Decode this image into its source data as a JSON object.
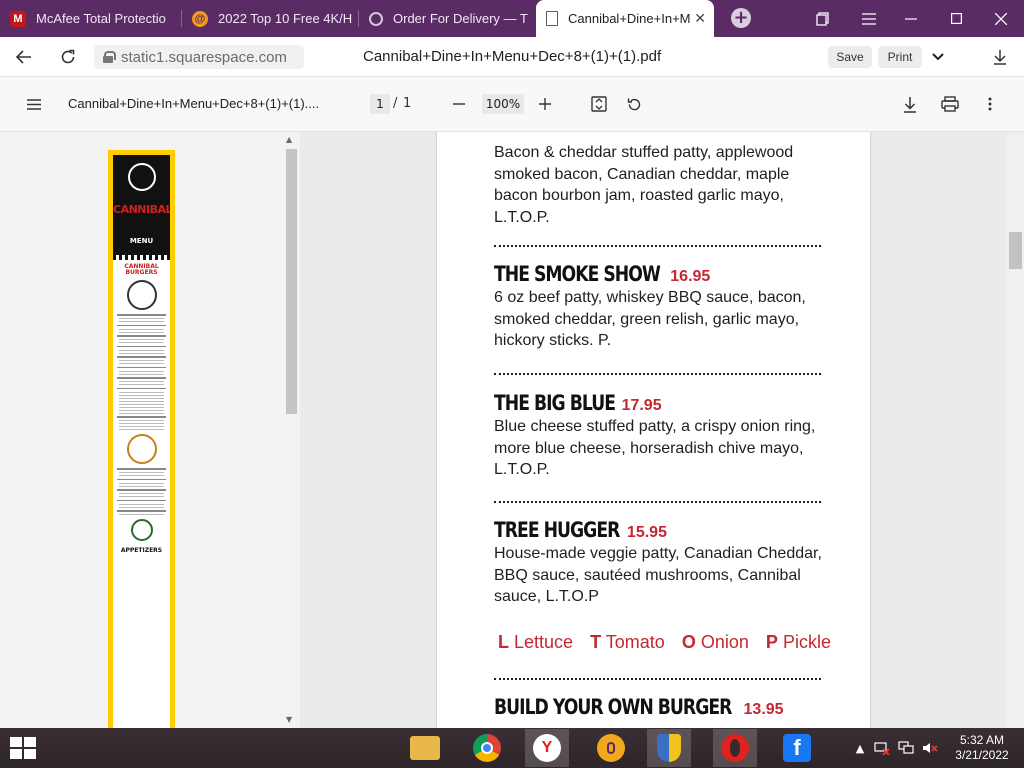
{
  "browser": {
    "tabs": [
      {
        "label": "McAfee Total Protectio",
        "icon": "mcafee-icon",
        "color": "#c01818"
      },
      {
        "label": "2022 Top 10 Free 4K/H",
        "icon": "swirl-icon",
        "color": "#f39a1c"
      },
      {
        "label": "Order For Delivery — T",
        "icon": "globe-icon",
        "color": "#d8c7df"
      },
      {
        "label": "Cannibal+Dine+In+M",
        "icon": "pdf-icon",
        "color": "#5a5a5a"
      }
    ],
    "address": "static1.squarespace.com",
    "document_title": "Cannibal+Dine+In+Menu+Dec+8+(1)+(1).pdf",
    "save_label": "Save",
    "print_label": "Print"
  },
  "pdf_toolbar": {
    "title": "Cannibal+Dine+In+Menu+Dec+8+(1)+(1)....",
    "page_current": "1",
    "page_separator": "/",
    "page_total": "1",
    "zoom": "100%"
  },
  "thumbnail": {
    "brand": "CANNIBAL",
    "menu_label": "MENU",
    "section_burgers": "CANNIBAL BURGERS",
    "section_appetizers": "APPETIZERS"
  },
  "menu": {
    "partial_item": {
      "description": "Bacon & cheddar stuffed patty, applewood smoked bacon, Canadian cheddar, maple bacon bourbon jam, roasted garlic mayo, L.T.O.P."
    },
    "items": [
      {
        "name": "THE SMOKE SHOW",
        "price": "16.95",
        "description": "6 oz beef patty, whiskey BBQ sauce, bacon, smoked cheddar, green relish, garlic mayo, hickory sticks. P."
      },
      {
        "name": "THE BIG BLUE",
        "price": "17.95",
        "description": "Blue cheese stuffed patty, a crispy onion ring, more blue cheese, horseradish chive mayo, L.T.O.P."
      },
      {
        "name": "TREE HUGGER",
        "price": "15.95",
        "description": "House-made veggie patty, Canadian Cheddar, BBQ sauce, sautéed mushrooms, Cannibal sauce, L.T.O.P"
      }
    ],
    "legend": [
      {
        "key": "L",
        "word": "Lettuce"
      },
      {
        "key": "T",
        "word": "Tomato"
      },
      {
        "key": "O",
        "word": "Onion"
      },
      {
        "key": "P",
        "word": "Pickle"
      }
    ],
    "next_item": {
      "name": "BUILD YOUR OWN BURGER",
      "price": "13.95"
    }
  },
  "taskbar": {
    "time": "5:32 AM",
    "date": "3/21/2022",
    "apps": [
      {
        "icon": "file-explorer-icon",
        "color": "#e8b84a"
      },
      {
        "icon": "chrome-icon",
        "color": "#2f9e44"
      },
      {
        "icon": "yandex-icon",
        "color": "#e51c23"
      },
      {
        "icon": "key-icon",
        "color": "#f2a81c"
      },
      {
        "icon": "shield-icon",
        "color": "#3a6fc4"
      },
      {
        "icon": "opera-icon",
        "color": "#e0221f"
      },
      {
        "icon": "facebook-icon",
        "color": "#1877f2"
      }
    ]
  },
  "colors": {
    "tabstrip": "#5b2b66",
    "price_red": "#c42830",
    "thumb_border": "#ffcc00"
  }
}
